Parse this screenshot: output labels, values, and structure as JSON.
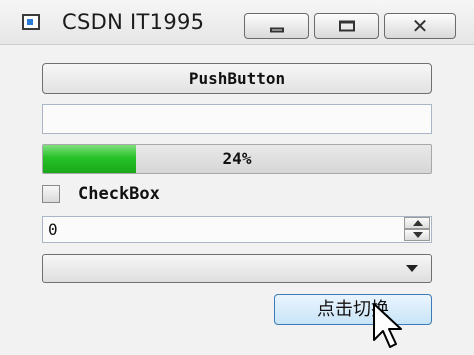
{
  "window": {
    "title": "CSDN IT1995",
    "icon": "app-window-icon",
    "controls": {
      "minimize": "minimize-icon",
      "maximize": "maximize-icon",
      "close_glyph": "✕"
    }
  },
  "push_button": {
    "label": "PushButton"
  },
  "line_edit": {
    "value": ""
  },
  "progress": {
    "value": 24,
    "text": "24%"
  },
  "checkbox": {
    "label": "CheckBox",
    "checked": false
  },
  "spinbox": {
    "value": "0"
  },
  "combobox": {
    "selected": ""
  },
  "switch_button": {
    "label": "点击切换"
  },
  "colors": {
    "progress_fill": "#27c127",
    "switch_button_border": "#3d7bb8",
    "window_bg": "#f2f2f2"
  }
}
